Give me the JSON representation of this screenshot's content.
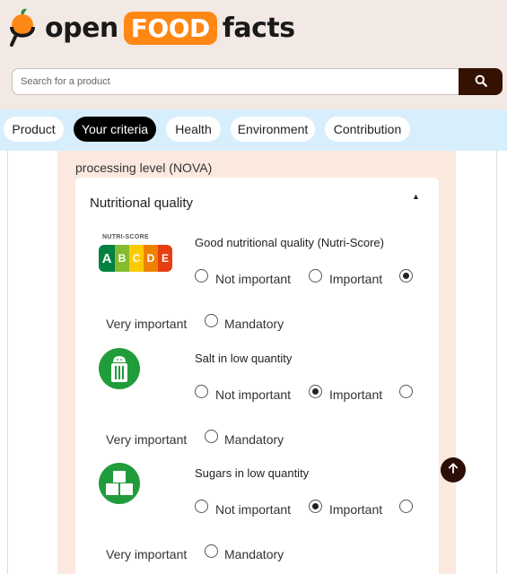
{
  "header": {
    "logo": {
      "word1": "open",
      "word2": "FOOD",
      "word3": "facts"
    },
    "search": {
      "placeholder": "Search for a product",
      "button_icon": "search-icon"
    }
  },
  "tabs": [
    {
      "label": "Product",
      "active": false
    },
    {
      "label": "Your criteria",
      "active": true
    },
    {
      "label": "Health",
      "active": false
    },
    {
      "label": "Environment",
      "active": false
    },
    {
      "label": "Contribution",
      "active": false
    }
  ],
  "main": {
    "prev_criterion_tail": "processing level (NOVA)",
    "section": {
      "title": "Nutritional quality",
      "collapse_icon": "caret-up-icon",
      "options": {
        "not_important": "Not important",
        "important": "Important",
        "very_important": "Very important",
        "mandatory": "Mandatory"
      },
      "criteria": [
        {
          "title": "Good nutritional quality (Nutri-Score)",
          "icon": "nutri-score-icon",
          "selected": "very_important",
          "nutriscore": {
            "label": "NUTRI-SCORE",
            "grades": [
              "A",
              "B",
              "C",
              "D",
              "E"
            ],
            "colors": [
              "#038141",
              "#85bb2f",
              "#fecb02",
              "#ee8100",
              "#e63e11"
            ]
          }
        },
        {
          "title": "Salt in low quantity",
          "icon": "salt-shaker-icon",
          "selected": "important"
        },
        {
          "title": "Sugars in low quantity",
          "icon": "sugar-cubes-icon",
          "selected": "important"
        }
      ]
    }
  },
  "scroll_to_top_icon": "arrow-up-icon"
}
